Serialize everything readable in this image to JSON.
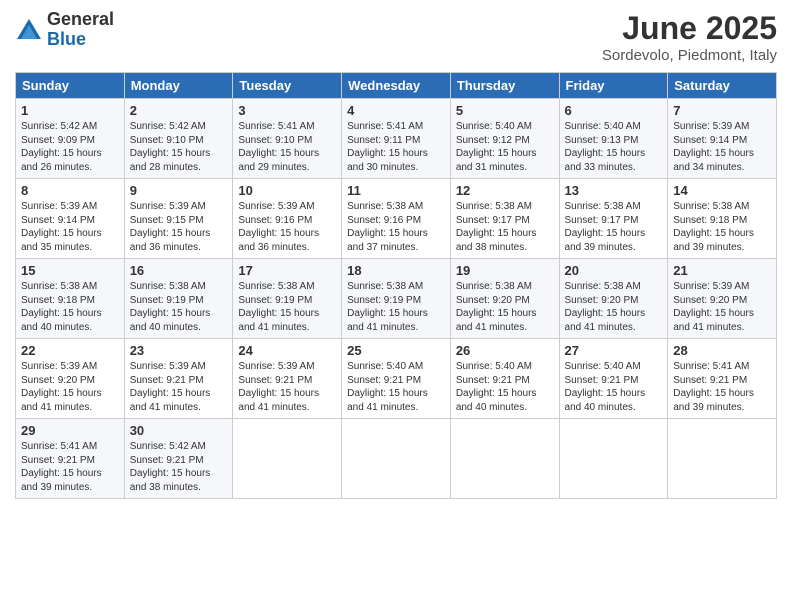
{
  "logo": {
    "general": "General",
    "blue": "Blue"
  },
  "title": "June 2025",
  "subtitle": "Sordevolo, Piedmont, Italy",
  "headers": [
    "Sunday",
    "Monday",
    "Tuesday",
    "Wednesday",
    "Thursday",
    "Friday",
    "Saturday"
  ],
  "weeks": [
    [
      {
        "day": "1",
        "info": "Sunrise: 5:42 AM\nSunset: 9:09 PM\nDaylight: 15 hours\nand 26 minutes."
      },
      {
        "day": "2",
        "info": "Sunrise: 5:42 AM\nSunset: 9:10 PM\nDaylight: 15 hours\nand 28 minutes."
      },
      {
        "day": "3",
        "info": "Sunrise: 5:41 AM\nSunset: 9:10 PM\nDaylight: 15 hours\nand 29 minutes."
      },
      {
        "day": "4",
        "info": "Sunrise: 5:41 AM\nSunset: 9:11 PM\nDaylight: 15 hours\nand 30 minutes."
      },
      {
        "day": "5",
        "info": "Sunrise: 5:40 AM\nSunset: 9:12 PM\nDaylight: 15 hours\nand 31 minutes."
      },
      {
        "day": "6",
        "info": "Sunrise: 5:40 AM\nSunset: 9:13 PM\nDaylight: 15 hours\nand 33 minutes."
      },
      {
        "day": "7",
        "info": "Sunrise: 5:39 AM\nSunset: 9:14 PM\nDaylight: 15 hours\nand 34 minutes."
      }
    ],
    [
      {
        "day": "8",
        "info": "Sunrise: 5:39 AM\nSunset: 9:14 PM\nDaylight: 15 hours\nand 35 minutes."
      },
      {
        "day": "9",
        "info": "Sunrise: 5:39 AM\nSunset: 9:15 PM\nDaylight: 15 hours\nand 36 minutes."
      },
      {
        "day": "10",
        "info": "Sunrise: 5:39 AM\nSunset: 9:16 PM\nDaylight: 15 hours\nand 36 minutes."
      },
      {
        "day": "11",
        "info": "Sunrise: 5:38 AM\nSunset: 9:16 PM\nDaylight: 15 hours\nand 37 minutes."
      },
      {
        "day": "12",
        "info": "Sunrise: 5:38 AM\nSunset: 9:17 PM\nDaylight: 15 hours\nand 38 minutes."
      },
      {
        "day": "13",
        "info": "Sunrise: 5:38 AM\nSunset: 9:17 PM\nDaylight: 15 hours\nand 39 minutes."
      },
      {
        "day": "14",
        "info": "Sunrise: 5:38 AM\nSunset: 9:18 PM\nDaylight: 15 hours\nand 39 minutes."
      }
    ],
    [
      {
        "day": "15",
        "info": "Sunrise: 5:38 AM\nSunset: 9:18 PM\nDaylight: 15 hours\nand 40 minutes."
      },
      {
        "day": "16",
        "info": "Sunrise: 5:38 AM\nSunset: 9:19 PM\nDaylight: 15 hours\nand 40 minutes."
      },
      {
        "day": "17",
        "info": "Sunrise: 5:38 AM\nSunset: 9:19 PM\nDaylight: 15 hours\nand 41 minutes."
      },
      {
        "day": "18",
        "info": "Sunrise: 5:38 AM\nSunset: 9:19 PM\nDaylight: 15 hours\nand 41 minutes."
      },
      {
        "day": "19",
        "info": "Sunrise: 5:38 AM\nSunset: 9:20 PM\nDaylight: 15 hours\nand 41 minutes."
      },
      {
        "day": "20",
        "info": "Sunrise: 5:38 AM\nSunset: 9:20 PM\nDaylight: 15 hours\nand 41 minutes."
      },
      {
        "day": "21",
        "info": "Sunrise: 5:39 AM\nSunset: 9:20 PM\nDaylight: 15 hours\nand 41 minutes."
      }
    ],
    [
      {
        "day": "22",
        "info": "Sunrise: 5:39 AM\nSunset: 9:20 PM\nDaylight: 15 hours\nand 41 minutes."
      },
      {
        "day": "23",
        "info": "Sunrise: 5:39 AM\nSunset: 9:21 PM\nDaylight: 15 hours\nand 41 minutes."
      },
      {
        "day": "24",
        "info": "Sunrise: 5:39 AM\nSunset: 9:21 PM\nDaylight: 15 hours\nand 41 minutes."
      },
      {
        "day": "25",
        "info": "Sunrise: 5:40 AM\nSunset: 9:21 PM\nDaylight: 15 hours\nand 41 minutes."
      },
      {
        "day": "26",
        "info": "Sunrise: 5:40 AM\nSunset: 9:21 PM\nDaylight: 15 hours\nand 40 minutes."
      },
      {
        "day": "27",
        "info": "Sunrise: 5:40 AM\nSunset: 9:21 PM\nDaylight: 15 hours\nand 40 minutes."
      },
      {
        "day": "28",
        "info": "Sunrise: 5:41 AM\nSunset: 9:21 PM\nDaylight: 15 hours\nand 39 minutes."
      }
    ],
    [
      {
        "day": "29",
        "info": "Sunrise: 5:41 AM\nSunset: 9:21 PM\nDaylight: 15 hours\nand 39 minutes."
      },
      {
        "day": "30",
        "info": "Sunrise: 5:42 AM\nSunset: 9:21 PM\nDaylight: 15 hours\nand 38 minutes."
      },
      {
        "day": "",
        "info": ""
      },
      {
        "day": "",
        "info": ""
      },
      {
        "day": "",
        "info": ""
      },
      {
        "day": "",
        "info": ""
      },
      {
        "day": "",
        "info": ""
      }
    ]
  ]
}
